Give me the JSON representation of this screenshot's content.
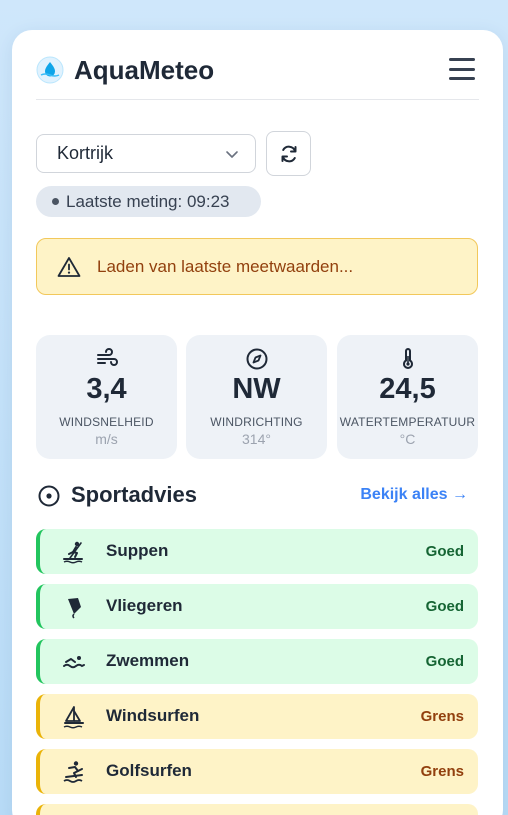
{
  "app": {
    "title": "AquaMeteo"
  },
  "header": {
    "menu_icon": "hamburger-menu-icon",
    "logo_icon": "water-drop-logo-icon"
  },
  "location": {
    "selected": "Kortrijk"
  },
  "status": {
    "last_measurement": "Laatste meting: 09:23"
  },
  "alert": {
    "message": "Laden van laatste meetwaarden...",
    "icon": "warning-icon"
  },
  "stats": [
    {
      "icon": "wind-icon",
      "value": "3,4",
      "label": "WINDSNELHEID",
      "unit": "m/s"
    },
    {
      "icon": "compass-icon",
      "value": "NW",
      "label": "WINDRICHTING",
      "unit": "314°"
    },
    {
      "icon": "thermometer-icon",
      "value": "24,5",
      "label": "WATERTEMPERATUUR",
      "unit": "°C"
    }
  ],
  "sports": {
    "title": "Sportadvies",
    "view_all": "Bekijk alles →",
    "items": [
      {
        "name": "Suppen",
        "status": "Goed",
        "level": "good",
        "icon": "sup-icon"
      },
      {
        "name": "Vliegeren",
        "status": "Goed",
        "level": "good",
        "icon": "kite-icon"
      },
      {
        "name": "Zwemmen",
        "status": "Goed",
        "level": "good",
        "icon": "swimming-icon"
      },
      {
        "name": "Windsurfen",
        "status": "Grens",
        "level": "warn",
        "icon": "windsurf-icon"
      },
      {
        "name": "Golfsurfen",
        "status": "Grens",
        "level": "warn",
        "icon": "surfing-icon"
      }
    ]
  },
  "colors": {
    "accent": "#3b82f6",
    "good_bg": "#dcfce7",
    "good_border": "#22c55e",
    "warn_bg": "#fef3c7",
    "warn_border": "#eab308"
  }
}
